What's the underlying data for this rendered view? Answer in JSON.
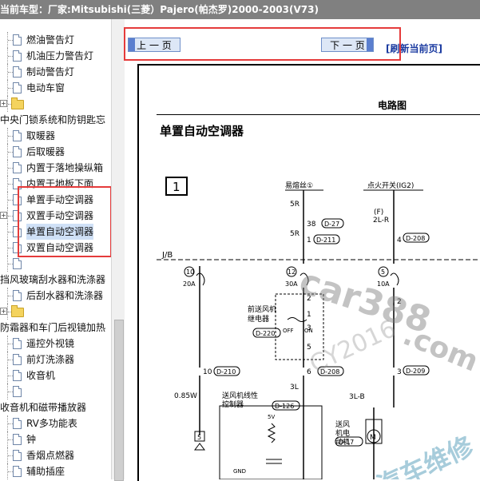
{
  "header": {
    "prefix": "当前车型：",
    "vehicle": "厂家:Mitsubishi(三菱）Pajero(帕杰罗)2000-2003(V73)"
  },
  "tree": {
    "items": [
      {
        "label": "燃油警告灯",
        "kind": "doc"
      },
      {
        "label": "机油压力警告灯",
        "kind": "doc"
      },
      {
        "label": "制动警告灯",
        "kind": "doc"
      },
      {
        "label": "电动车窗",
        "kind": "doc"
      },
      {
        "label": "",
        "kind": "folder"
      },
      {
        "label": "中央门锁系统和防钥匙忘",
        "kind": "category"
      },
      {
        "label": "取暖器",
        "kind": "doc"
      },
      {
        "label": "后取暖器",
        "kind": "doc"
      },
      {
        "label": "内置于落地操纵箱",
        "kind": "doc"
      },
      {
        "label": "内置于地板下面",
        "kind": "doc"
      },
      {
        "label": "单置手动空调器",
        "kind": "doc"
      },
      {
        "label": "双置手动空调器",
        "kind": "folderdoc"
      },
      {
        "label": "单置自动空调器",
        "kind": "doc",
        "selected": true
      },
      {
        "label": "双置自动空调器",
        "kind": "doc"
      },
      {
        "label": "",
        "kind": "doc"
      },
      {
        "label": "挡风玻璃刮水器和洗涤器",
        "kind": "category"
      },
      {
        "label": "后刮水器和洗涤器",
        "kind": "doc"
      },
      {
        "label": "",
        "kind": "folder"
      },
      {
        "label": "防霜器和车门后视镜加热",
        "kind": "category"
      },
      {
        "label": "遥控外视镜",
        "kind": "doc"
      },
      {
        "label": "前灯洗涤器",
        "kind": "doc"
      },
      {
        "label": "收音机",
        "kind": "doc"
      },
      {
        "label": "",
        "kind": "doc"
      },
      {
        "label": "收音机和磁带播放器",
        "kind": "category"
      },
      {
        "label": "RV多功能表",
        "kind": "doc"
      },
      {
        "label": "钟",
        "kind": "doc"
      },
      {
        "label": "香烟点燃器",
        "kind": "doc"
      },
      {
        "label": "辅助插座",
        "kind": "doc"
      },
      {
        "label": "",
        "kind": "doc"
      }
    ]
  },
  "nav": {
    "prev_label": "上 一 页",
    "next_label": "下 一 页",
    "refresh_label": "[刷新当前页]"
  },
  "diagram": {
    "header_title": "电路图",
    "title": "单置自动空调器",
    "page_num": "1",
    "fuse_label": "易熔丝①",
    "ignition_label": "点火开关(IG2)",
    "w_5R_top": "5R",
    "w_5R_bot": "5R",
    "conn_38": "38",
    "conn_D27": "D-27",
    "conn_1": "1",
    "conn_D211": "D-211",
    "f_label": "(F)",
    "w_2LR": "2L-R",
    "pin_4": "4",
    "conn_D208": "D-208",
    "jb": "J/B",
    "fuse10": "10",
    "fuse10_a": "20A",
    "fuse12": "12",
    "fuse12_a": "30A",
    "fuse5": "5",
    "fuse5_a": "10A",
    "relay_label_1": "前送风机",
    "relay_label_2": "继电器",
    "relay_conn": "D-220",
    "off": "OFF",
    "on": "ON",
    "pin_2": "2",
    "pin_1b": "1",
    "pin_3": "3",
    "pin_5": "5",
    "pin_2b": "2",
    "pin_10": "10",
    "conn_D210": "D-210",
    "pin_6": "6",
    "conn_D208b": "D-208",
    "pin_3b": "3",
    "conn_D209": "D-209",
    "w_085w": "0.85W",
    "blower_ctrl_1": "送风机线性",
    "blower_ctrl_2": "控制器",
    "conn_D126": "D-126",
    "w_3L": "3L",
    "w_3LB": "3L-B",
    "motor_1": "送风",
    "motor_2": "机电",
    "motor_3": "动机",
    "conn_D17": "D-17",
    "gnd": "GND",
    "v5": "5V",
    "conn_5": "5"
  },
  "watermark": {
    "text1": "car388",
    "text2": ".com",
    "text3": "汽车维修",
    "text4": "CY2016"
  }
}
